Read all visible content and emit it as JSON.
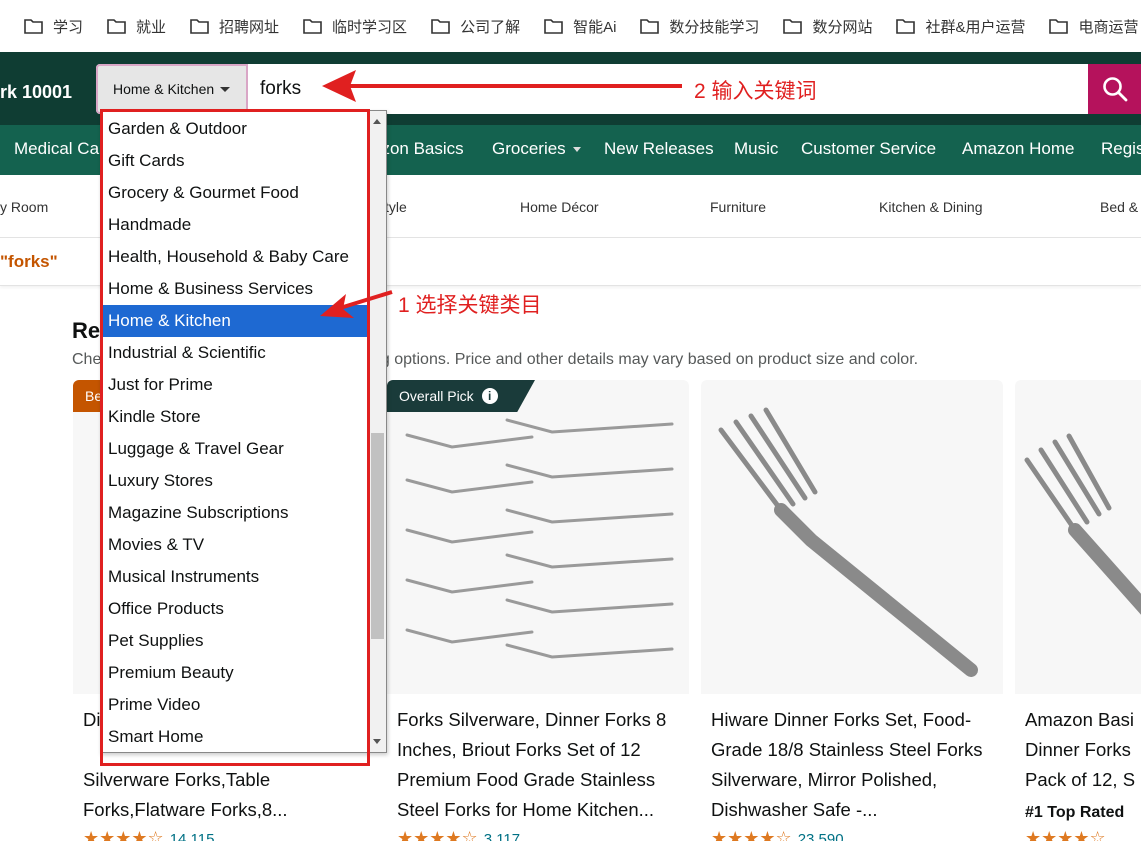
{
  "bookmarks": [
    "学习",
    "就业",
    "招聘网址",
    "临时学习区",
    "公司了解",
    "智能Ai",
    "数分技能学习",
    "数分网站",
    "社群&用户运营",
    "电商运营"
  ],
  "header": {
    "location": "rk 10001",
    "category_selected": "Home & Kitchen",
    "search_value": "forks"
  },
  "nav": {
    "items": [
      "Medical Ca",
      "azon Basics",
      "Groceries",
      "New Releases",
      "Music",
      "Customer Service",
      "Amazon Home",
      "Regis"
    ]
  },
  "subnav": {
    "items": [
      "y Room",
      "tyle",
      "Home Décor",
      "Furniture",
      "Kitchen & Dining",
      "Bed &"
    ]
  },
  "results": {
    "query": "\"forks\""
  },
  "section": {
    "title": "Re",
    "subtitle_left": "Che",
    "subtitle_right": "ng options. Price and other details may vary based on product size and color."
  },
  "dropdown": {
    "items": [
      "Garden & Outdoor",
      "Gift Cards",
      "Grocery & Gourmet Food",
      "Handmade",
      "Health, Household & Baby Care",
      "Home & Business Services",
      "Home & Kitchen",
      "Industrial & Scientific",
      "Just for Prime",
      "Kindle Store",
      "Luggage & Travel Gear",
      "Luxury Stores",
      "Magazine Subscriptions",
      "Movies & TV",
      "Musical Instruments",
      "Office Products",
      "Pet Supplies",
      "Premium Beauty",
      "Prime Video",
      "Smart Home"
    ],
    "selected_index": 6
  },
  "products": [
    {
      "badge": "Be",
      "title": "Di... Food Grade Stainless Steel Silverware Forks,Table Forks,Flatware Forks,8...",
      "title_visible": "Silverware Forks,Table Forks,Flatware Forks,8...",
      "title_partial": "Di",
      "rating_count": "14,115"
    },
    {
      "badge": "Overall Pick",
      "title": "Forks Silverware, Dinner Forks 8 Inches, Briout Forks Set of 12 Premium Food Grade Stainless Steel Forks for Home Kitchen...",
      "rating_count": "3,117"
    },
    {
      "title": "Hiware Dinner Forks Set, Food-Grade 18/8 Stainless Steel Forks Silverware, Mirror Polished, Dishwasher Safe -...",
      "rating_count": "23,590"
    },
    {
      "title": "Amazon Basi Dinner Forks Pack of 12, S",
      "toprated": "#1 Top Rated"
    }
  ],
  "annotations": {
    "step2": "2  输入关键词",
    "step1": "1 选择关键类目"
  },
  "colors": {
    "header_bg": "#0f3d33",
    "nav_bg": "#14624f",
    "search_button": "#b5125c",
    "selected_option": "#1e69d2",
    "annotation_red": "#e02020",
    "badge_orange": "#c45500",
    "badge_dark": "#1a3b3a"
  }
}
